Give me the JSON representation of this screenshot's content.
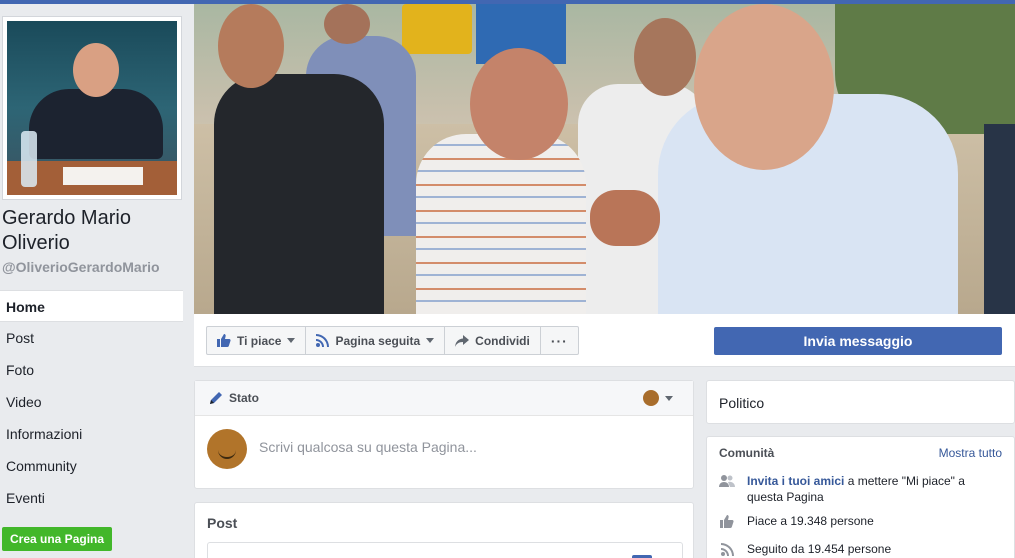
{
  "colors": {
    "accent": "#4267b2",
    "green": "#42b72a",
    "link": "#365899",
    "background": "#e9ebee"
  },
  "profile": {
    "name": "Gerardo Mario Oliverio",
    "handle": "@OliverioGerardoMario"
  },
  "nav": {
    "items": [
      {
        "label": "Home",
        "active": true
      },
      {
        "label": "Post"
      },
      {
        "label": "Foto"
      },
      {
        "label": "Video"
      },
      {
        "label": "Informazioni"
      },
      {
        "label": "Community"
      },
      {
        "label": "Eventi"
      }
    ],
    "create_page": "Crea una Pagina"
  },
  "actions": {
    "like": {
      "label": "Ti piace",
      "icon": "thumbs-up-icon"
    },
    "follow": {
      "label": "Pagina seguita",
      "icon": "rss-icon"
    },
    "share": {
      "label": "Condividi",
      "icon": "share-arrow-icon"
    },
    "more": {
      "label": "···",
      "icon": "more-icon"
    },
    "send_message": "Invia messaggio"
  },
  "composer": {
    "tab": "Stato",
    "placeholder": "Scrivi qualcosa su questa Pagina..."
  },
  "posts": {
    "title": "Post"
  },
  "category": {
    "label": "Politico"
  },
  "community": {
    "title": "Comunità",
    "see_all": "Mostra tutto",
    "invite_link": "Invita i tuoi amici",
    "invite_rest": " a mettere \"Mi piace\" a questa Pagina",
    "likes": "Piace a 19.348 persone",
    "follows": "Seguito da 19.454 persone"
  }
}
